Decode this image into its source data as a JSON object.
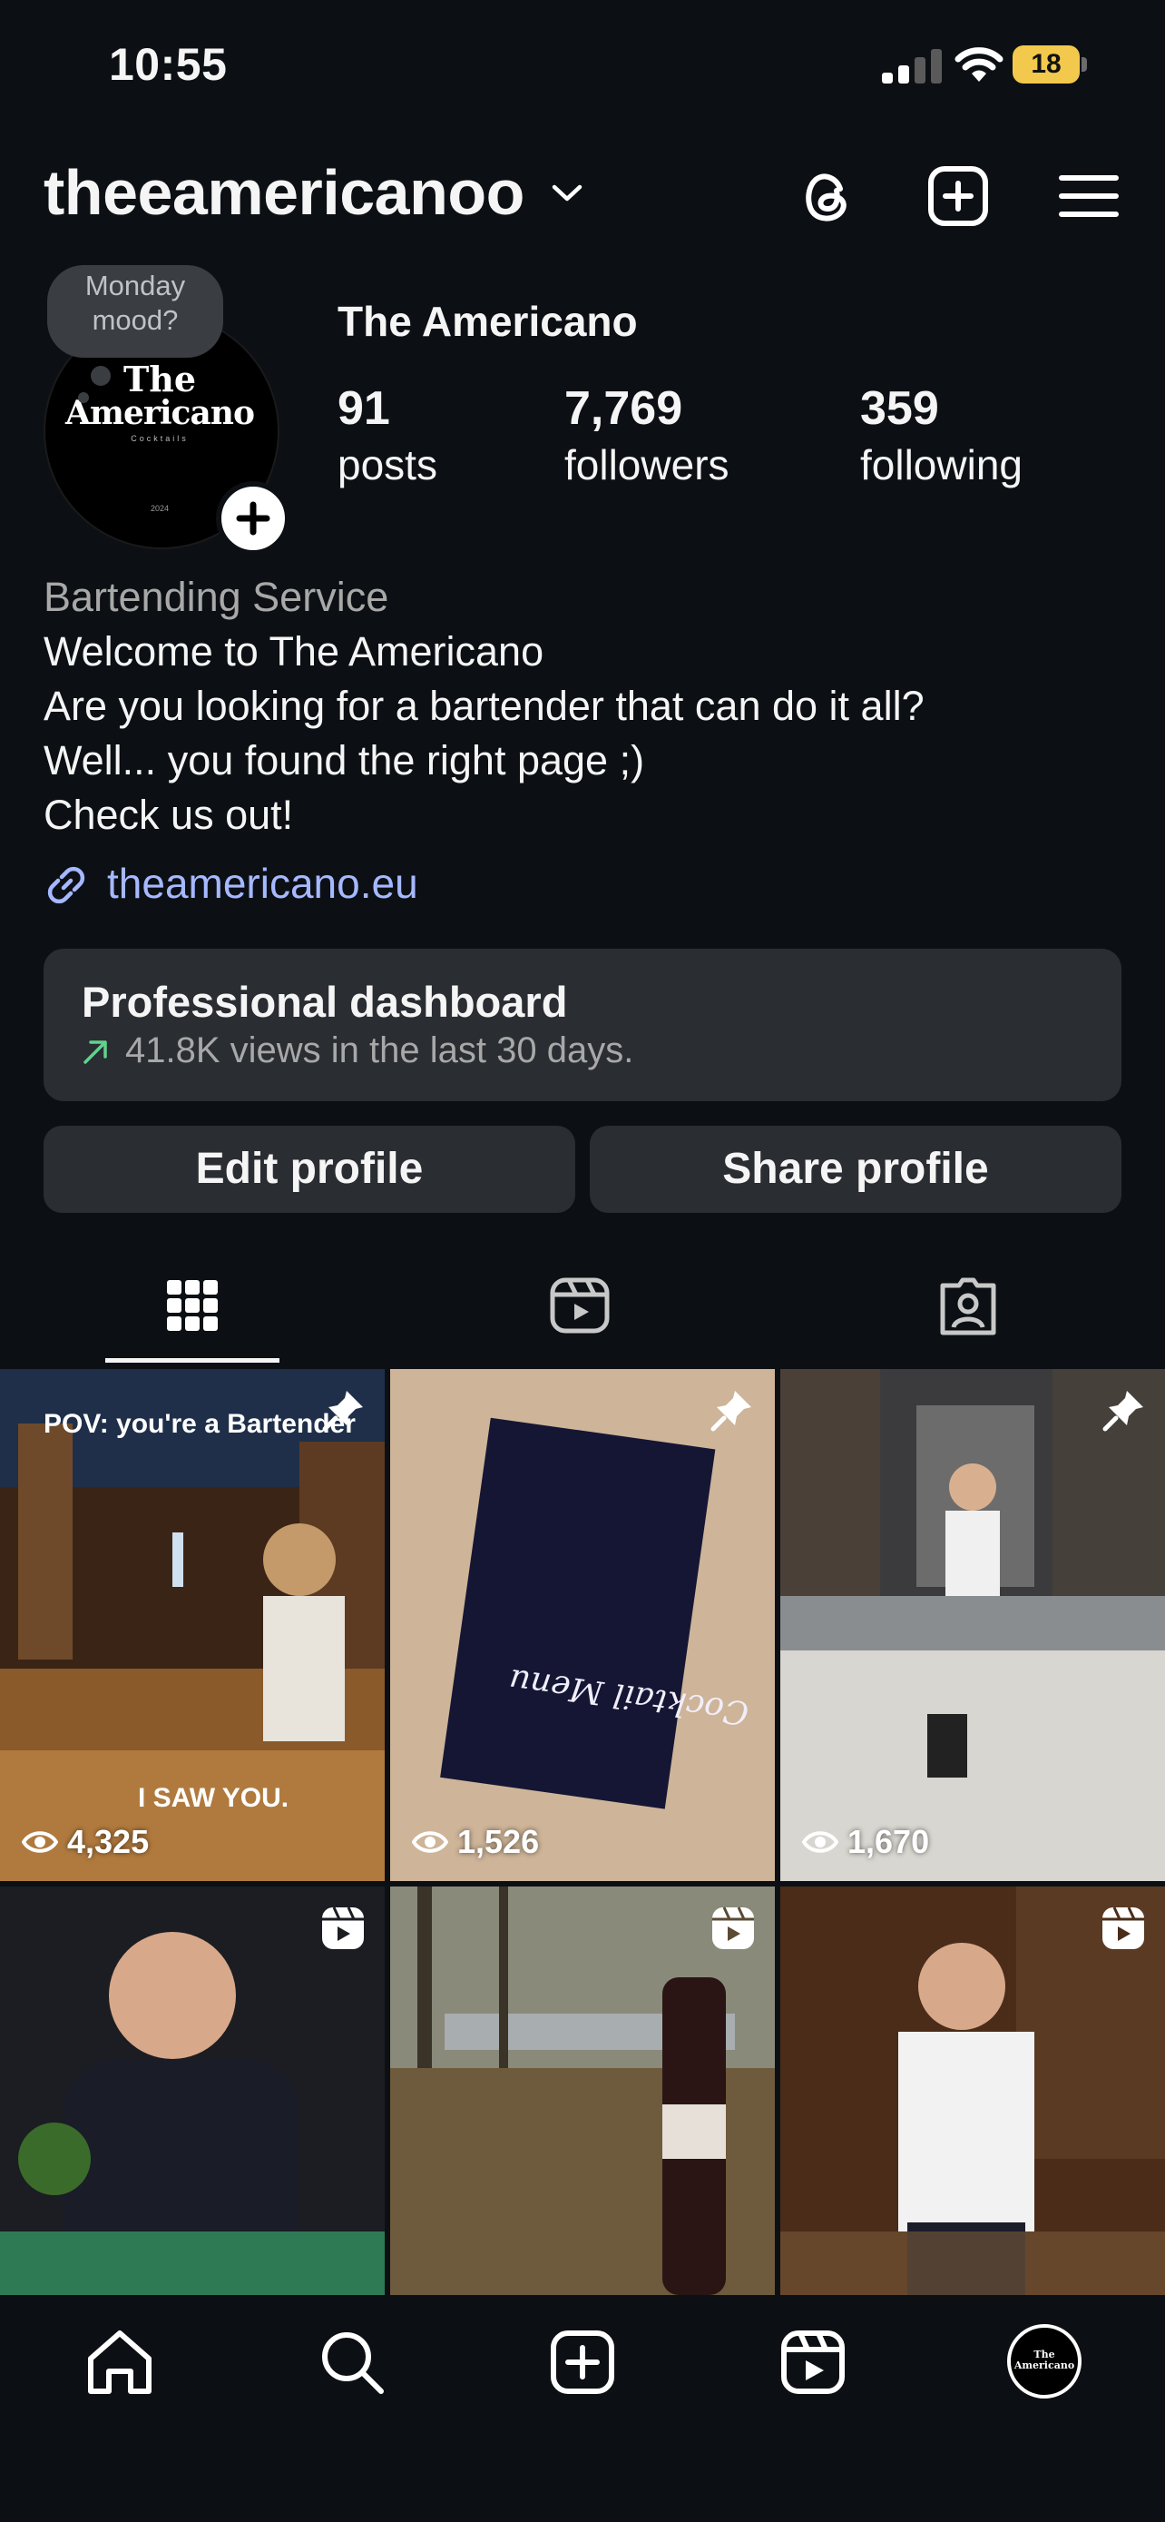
{
  "status_bar": {
    "time": "10:55",
    "battery": "18"
  },
  "header": {
    "username": "theeamericanoo",
    "icons": [
      "threads-icon",
      "create-icon",
      "menu-icon"
    ]
  },
  "profile": {
    "note": "Monday mood?",
    "avatar": {
      "line1": "The",
      "line2": "Americano",
      "line3": "Cocktails",
      "line4": "2024"
    },
    "display_name": "The Americano",
    "stats": [
      {
        "value": "91",
        "label": "posts"
      },
      {
        "value": "7,769",
        "label": "followers"
      },
      {
        "value": "359",
        "label": "following"
      }
    ],
    "category": "Bartending Service",
    "bio": [
      "Welcome to The Americano",
      "Are you looking for a bartender that can do it all?",
      "Well... you found the right page ;)",
      "Check us out!"
    ],
    "link": "theamericano.eu"
  },
  "dashboard": {
    "title": "Professional dashboard",
    "subtitle": "41.8K views in the last 30 days."
  },
  "buttons": {
    "edit": "Edit profile",
    "share": "Share profile"
  },
  "tabs": [
    "grid-tab",
    "reels-tab",
    "tagged-tab"
  ],
  "posts": [
    {
      "caption": "POV: you're a Bartender",
      "overlay": "I SAW YOU.",
      "views": "4,325",
      "pinned": true
    },
    {
      "caption": "",
      "overlay": "Cocktail Menu",
      "views": "1,526",
      "pinned": true
    },
    {
      "caption": "",
      "overlay": "",
      "views": "1,670",
      "pinned": true
    },
    {
      "caption": "",
      "overlay": "",
      "views": "",
      "reel": true
    },
    {
      "caption": "",
      "overlay": "",
      "views": "",
      "reel": true
    },
    {
      "caption": "",
      "overlay": "",
      "views": "",
      "reel": true
    }
  ],
  "nav": [
    "home-icon",
    "search-icon",
    "create-icon",
    "reels-icon",
    "profile-avatar"
  ],
  "nav_avatar": {
    "line1": "The",
    "line2": "Americano"
  },
  "colors": {
    "background": "#0c1014",
    "card": "#2a2d32",
    "link": "#a6b8ff",
    "battery": "#f2c94c",
    "trend": "#5fd38d"
  }
}
